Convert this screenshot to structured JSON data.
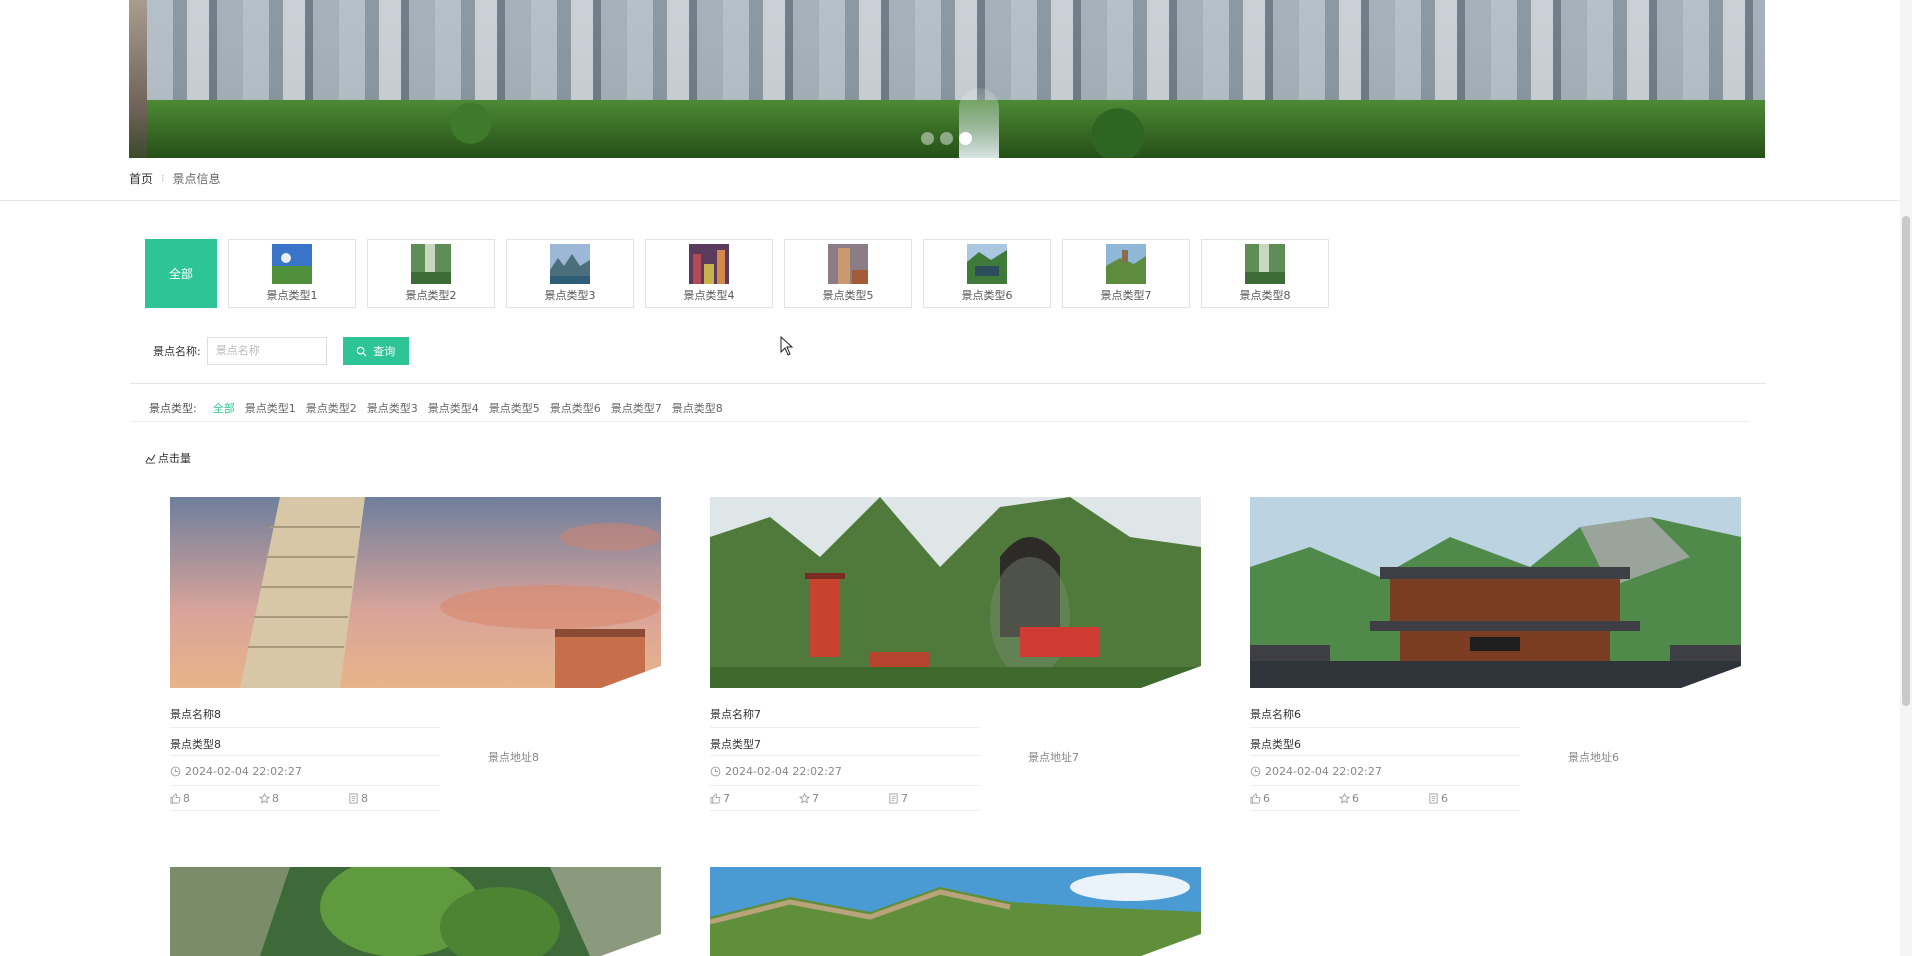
{
  "banner": {
    "active_slide": 3,
    "slide_count": 3
  },
  "breadcrumb": {
    "home": "首页",
    "separator": "⁝",
    "current": "景点信息"
  },
  "category_tiles": {
    "all_label": "全部",
    "items": [
      {
        "label": "景点类型1"
      },
      {
        "label": "景点类型2"
      },
      {
        "label": "景点类型3"
      },
      {
        "label": "景点类型4"
      },
      {
        "label": "景点类型5"
      },
      {
        "label": "景点类型6"
      },
      {
        "label": "景点类型7"
      },
      {
        "label": "景点类型8"
      }
    ]
  },
  "search": {
    "label": "景点名称:",
    "placeholder": "景点名称",
    "button_label": "查询"
  },
  "filter": {
    "title": "景点类型:",
    "options": [
      "全部",
      "景点类型1",
      "景点类型2",
      "景点类型3",
      "景点类型4",
      "景点类型5",
      "景点类型6",
      "景点类型7",
      "景点类型8"
    ],
    "active": "全部"
  },
  "sort": {
    "label": "点击量"
  },
  "cards": [
    {
      "name": "景点名称8",
      "type": "景点类型8",
      "address": "景点地址8",
      "time": "2024-02-04 22:02:27",
      "likes": "8",
      "favorites": "8",
      "comments": "8"
    },
    {
      "name": "景点名称7",
      "type": "景点类型7",
      "address": "景点地址7",
      "time": "2024-02-04 22:02:27",
      "likes": "7",
      "favorites": "7",
      "comments": "7"
    },
    {
      "name": "景点名称6",
      "type": "景点类型6",
      "address": "景点地址6",
      "time": "2024-02-04 22:02:27",
      "likes": "6",
      "favorites": "6",
      "comments": "6"
    }
  ],
  "colors": {
    "accent": "#2ec596"
  }
}
